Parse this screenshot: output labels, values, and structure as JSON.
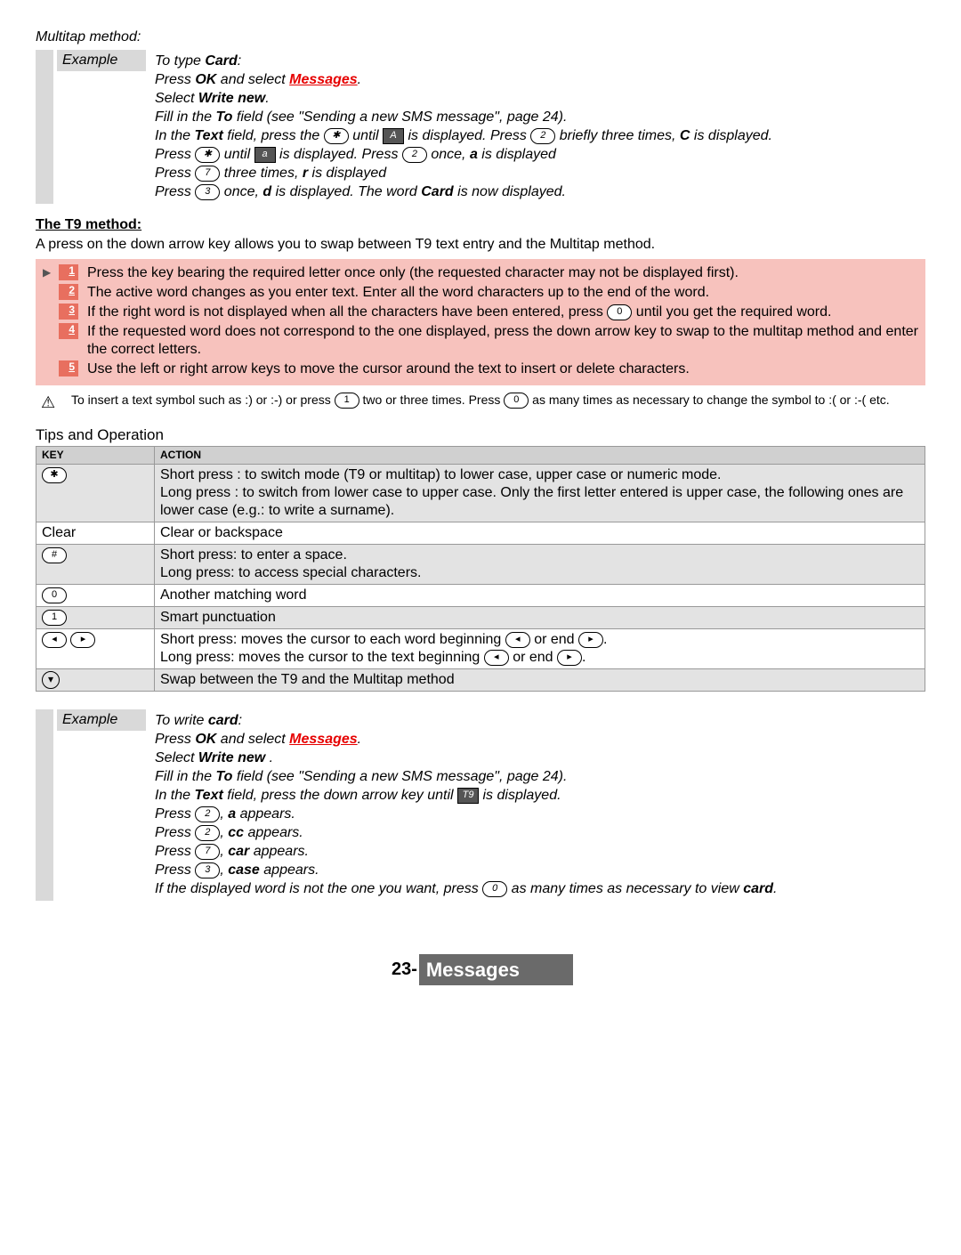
{
  "section1_title": "Multitap method:",
  "example_label": "Example",
  "ex1": {
    "l1_a": "To type ",
    "l1_b": "Card",
    "l1_c": ":",
    "l2_a": "Press ",
    "l2_b": "OK",
    "l2_c": " and select ",
    "l2_d": "Messages",
    "l2_e": ".",
    "l3_a": "Select ",
    "l3_b": "Write new",
    "l3_c": ".",
    "l4_a": "Fill in the ",
    "l4_b": "To",
    "l4_c": " field (see  \"Sending a new SMS message\", page 24).",
    "l5_a": "In the ",
    "l5_b": "Text",
    "l5_c": " field, press the  ",
    "l5_d": "  until ",
    "l5_e": " is displayed. Press ",
    "l5_f": " briefly three times, ",
    "l5_g": "C",
    "l5_h": " is displayed.",
    "l6_a": "Press ",
    "l6_b": " until ",
    "l6_c": " is displayed. Press ",
    "l6_d": " once, ",
    "l6_e": "a",
    "l6_f": " is displayed",
    "l7_a": "Press ",
    "l7_b": " three times, ",
    "l7_c": "r",
    "l7_d": " is displayed",
    "l8_a": "Press ",
    "l8_b": " once, ",
    "l8_c": "d",
    "l8_d": " is displayed. The word ",
    "l8_e": "Card",
    "l8_f": " is now displayed."
  },
  "t9_heading": "The T9 method:",
  "t9_intro": "A press on the down arrow key allows you to swap between T9 text entry and the Multitap method.",
  "steps": [
    "Press the key bearing the required letter once only (the requested character may not be displayed first).",
    "The active word changes as you enter text. Enter all the word characters up to the end of the word.",
    "If the right word is not displayed when all the characters have been entered, press __K0__ until you get the required word.",
    "If the requested word does not correspond to the one displayed, press the down arrow key to swap to the multitap method and enter the correct letters.",
    "Use the left or right arrow keys to move the cursor around the text to insert or delete characters."
  ],
  "warn_a": "To insert a text symbol such as :) or :-) or press ",
  "warn_b": " two or three times. Press ",
  "warn_c": " as many times as necessary to change the symbol to :( or :-( etc.",
  "tips_heading": "Tips and Operation",
  "table": {
    "h1": "KEY",
    "h2": "ACTION",
    "rows": [
      {
        "key_icon": "✱",
        "action": "Short press : to switch mode (T9 or multitap) to lower case, upper case or numeric mode.\nLong press : to switch from lower case to upper case. Only the first letter entered is upper case, the following ones are lower case (e.g.: to write a surname)."
      },
      {
        "key_text": "Clear",
        "action": "Clear or backspace"
      },
      {
        "key_icon": "#",
        "action": "Short press: to enter a space.\nLong press: to access special characters."
      },
      {
        "key_icon": "0",
        "action": "Another matching word"
      },
      {
        "key_icon": "1",
        "action": "Smart punctuation"
      },
      {
        "key_nav": true,
        "action_nav": true
      },
      {
        "key_down": true,
        "action": "Swap between the T9 and the Multitap method"
      }
    ],
    "nav_a": "Short press: moves the cursor to each word beginning ",
    "nav_b": " or end ",
    "nav_c": ".\nLong press: moves the cursor to the text beginning ",
    "nav_d": " or end ",
    "nav_e": "."
  },
  "ex2": {
    "l1_a": "To write ",
    "l1_b": "card",
    "l1_c": ":",
    "l2_a": "Press ",
    "l2_b": "OK",
    "l2_c": " and select ",
    "l2_d": "Messages",
    "l2_e": ".",
    "l3_a": "Select ",
    "l3_b": "Write new ",
    "l3_c": ".",
    "l4_a": "Fill in the ",
    "l4_b": "To",
    "l4_c": " field (see \"Sending a new SMS message\", page 24).",
    "l5_a": "In the ",
    "l5_b": "Text",
    "l5_c": " field, press the down arrow key until ",
    "l5_d": "  is displayed.",
    "l6_a": "Press ",
    "l6_b": ", ",
    "l6_c": "a",
    "l6_d": " appears.",
    "l7_a": "Press ",
    "l7_b": ", ",
    "l7_c": "cc",
    "l7_d": " appears.",
    "l8_a": "Press ",
    "l8_b": ", ",
    "l8_c": "car",
    "l8_d": " appears.",
    "l9_a": "Press ",
    "l9_b": ", ",
    "l9_c": "case",
    "l9_d": " appears.",
    "l10_a": "If the displayed word is not the one you want, press ",
    "l10_b": " as many times as necessary to view ",
    "l10_c": "card",
    "l10_d": "."
  },
  "keys": {
    "star": "✱",
    "hash": "#",
    "k0": "0",
    "k1": "1",
    "k2": "2",
    "k3": "3",
    "k7": "7",
    "left": "◂",
    "right": "▸",
    "down": "▾",
    "t9": "T9",
    "A": "A",
    "a": "a"
  },
  "footer": {
    "page": "23-",
    "title": "Messages"
  }
}
